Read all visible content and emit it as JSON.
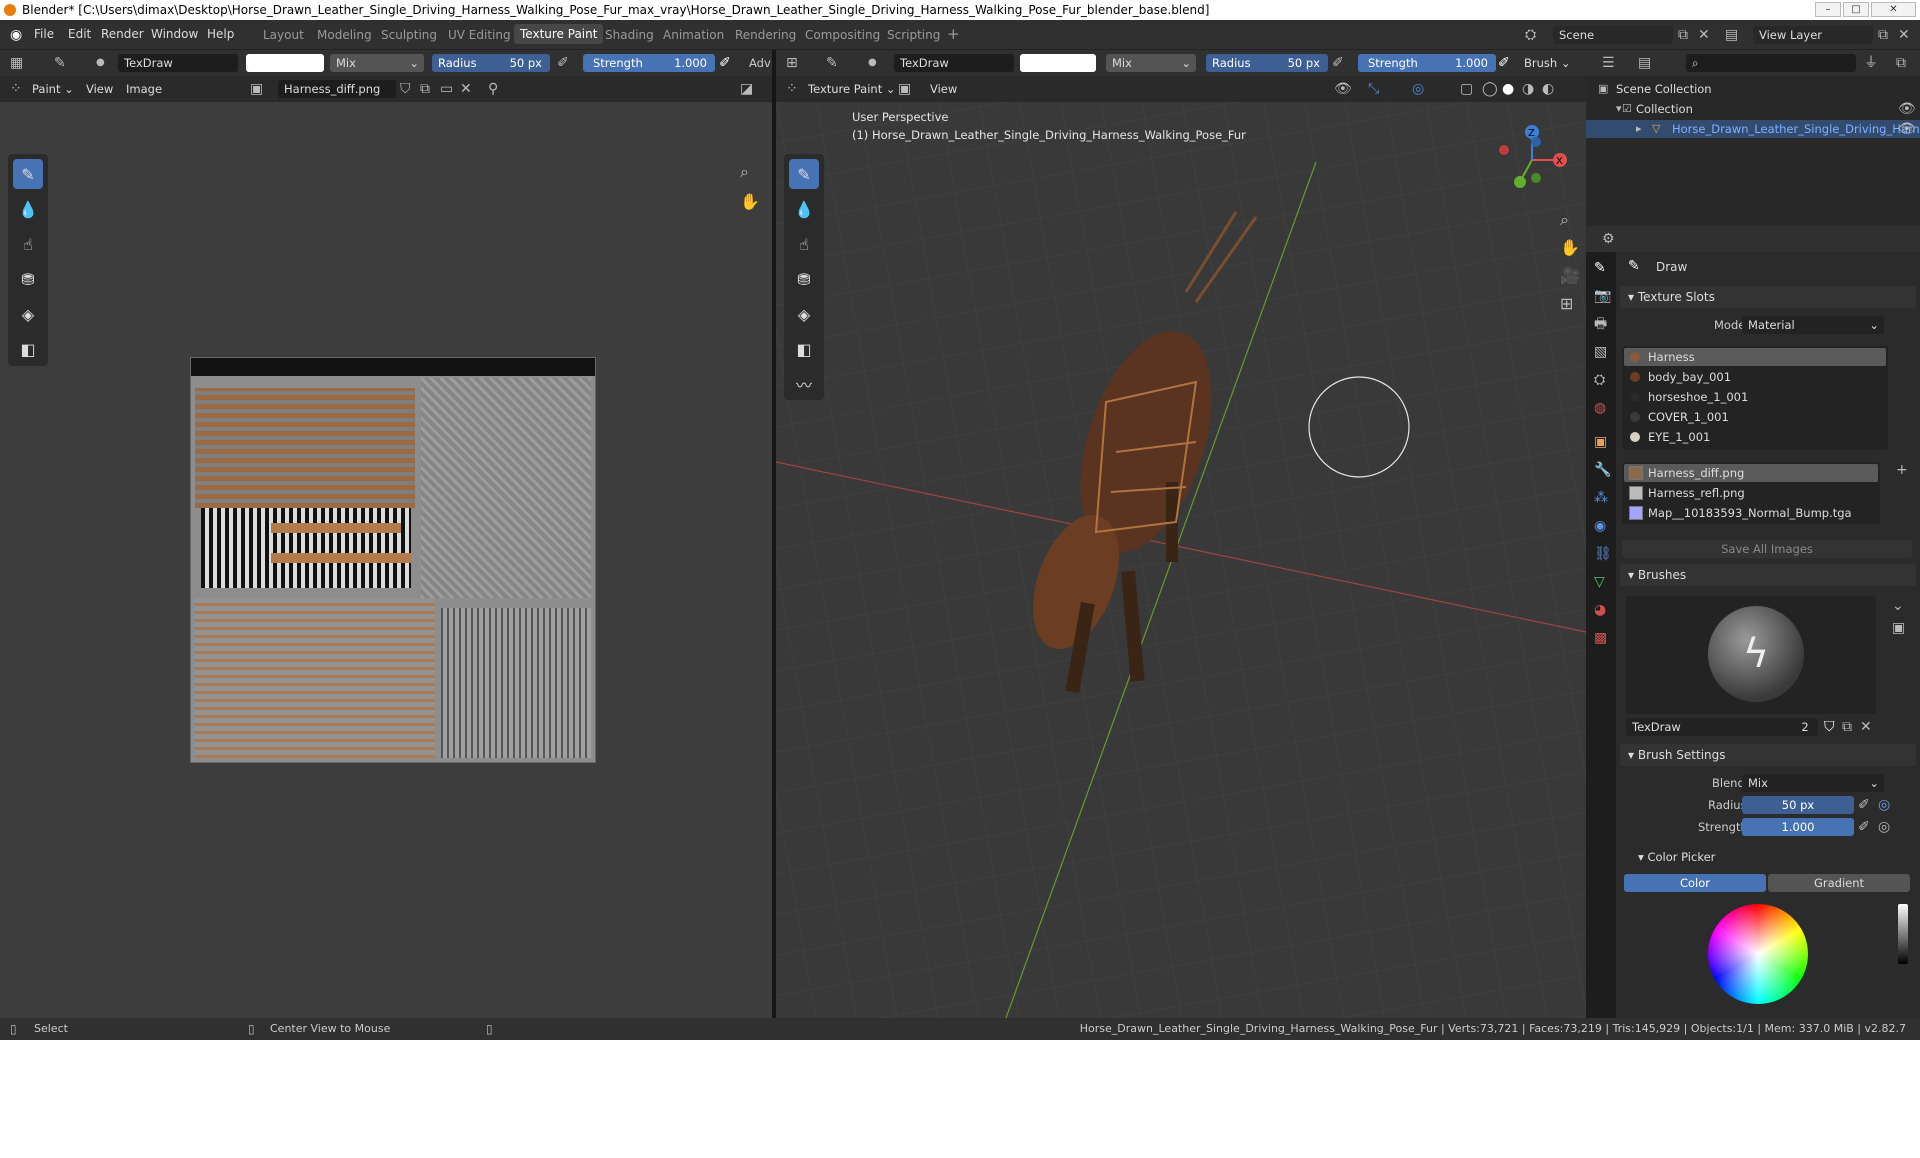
{
  "window": {
    "title": "Blender* [C:\\Users\\dimax\\Desktop\\Horse_Drawn_Leather_Single_Driving_Harness_Walking_Pose_Fur_max_vray\\Horse_Drawn_Leather_Single_Driving_Harness_Walking_Pose_Fur_blender_base.blend]"
  },
  "menu": {
    "file": "File",
    "edit": "Edit",
    "render": "Render",
    "window": "Window",
    "help": "Help"
  },
  "workspaces": [
    "Layout",
    "Modeling",
    "Sculpting",
    "UV Editing",
    "Texture Paint",
    "Shading",
    "Animation",
    "Rendering",
    "Compositing",
    "Scripting"
  ],
  "active_workspace": "Texture Paint",
  "scene": {
    "name": "Scene",
    "view_layer": "View Layer"
  },
  "left_header": {
    "brush": "TexDraw",
    "blend": "Mix",
    "radius_label": "Radius",
    "radius_value": "50 px",
    "strength_label": "Strength",
    "strength_value": "1.000",
    "adv": "Adv",
    "mode": "Paint",
    "view": "View",
    "image": "Image",
    "image_name": "Harness_diff.png"
  },
  "right_header": {
    "brush": "TexDraw",
    "blend": "Mix",
    "radius_label": "Radius",
    "radius_value": "50 px",
    "strength_label": "Strength",
    "strength_value": "1.000",
    "brush_menu": "Brush",
    "mode": "Texture Paint",
    "view": "View"
  },
  "viewport": {
    "perspective": "User Perspective",
    "object": "(1) Horse_Drawn_Leather_Single_Driving_Harness_Walking_Pose_Fur"
  },
  "outliner": {
    "scene_collection": "Scene Collection",
    "collection": "Collection",
    "object": "Horse_Drawn_Leather_Single_Driving_Harne"
  },
  "properties": {
    "tool_name": "Draw",
    "texture_slots_title": "Texture Slots",
    "mode_label": "Mode",
    "mode_value": "Material",
    "materials": [
      "Harness",
      "body_bay_001",
      "horseshoe_1_001",
      "COVER_1_001",
      "EYE_1_001"
    ],
    "material_colors": [
      "#8a5a3a",
      "#6b3d22",
      "#2a2a2a",
      "#3a3a3a",
      "#d8d0c0"
    ],
    "images": [
      "Harness_diff.png",
      "Harness_refl.png",
      "Map__10183593_Normal_Bump.tga"
    ],
    "save_all": "Save All Images",
    "brushes_title": "Brushes",
    "brush_name": "TexDraw",
    "brush_users": "2",
    "brush_settings_title": "Brush Settings",
    "blend_label": "Blend",
    "blend_value": "Mix",
    "radius_label": "Radius",
    "radius_value": "50 px",
    "strength_label": "Strength",
    "strength_value": "1.000",
    "color_picker_title": "Color Picker",
    "color_tab": "Color",
    "gradient_tab": "Gradient"
  },
  "status": {
    "select": "Select",
    "center_view": "Center View to Mouse",
    "stats": "Horse_Drawn_Leather_Single_Driving_Harness_Walking_Pose_Fur | Verts:73,721 | Faces:73,219 | Tris:145,929 | Objects:1/1 | Mem: 337.0 MiB | v2.82.7"
  }
}
